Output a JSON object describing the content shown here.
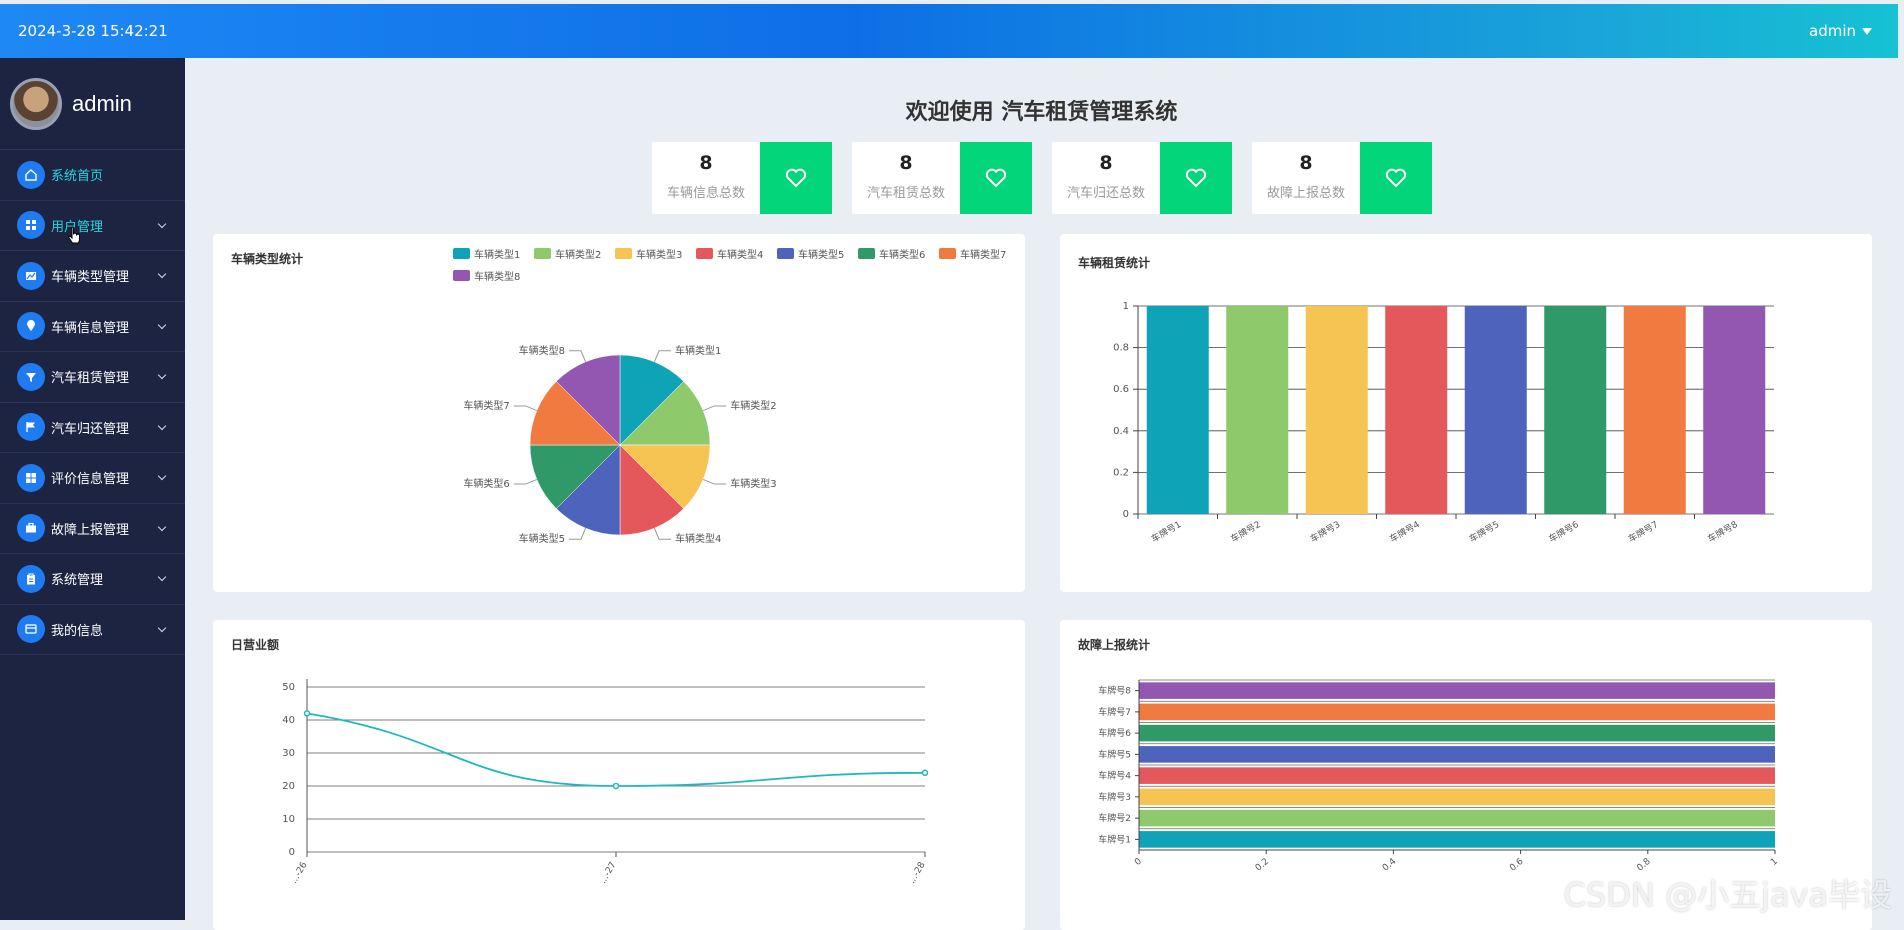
{
  "header": {
    "datetime": "2024-3-28 15:42:21",
    "user": "admin"
  },
  "sidebar": {
    "profile_name": "admin",
    "items": [
      {
        "label": "系统首页",
        "icon": "home-icon",
        "active": true,
        "has_chevron": false
      },
      {
        "label": "用户管理",
        "icon": "grid-icon",
        "active": false,
        "has_chevron": true
      },
      {
        "label": "车辆类型管理",
        "icon": "chart-icon",
        "active": false,
        "has_chevron": true
      },
      {
        "label": "车辆信息管理",
        "icon": "pin-icon",
        "active": false,
        "has_chevron": true
      },
      {
        "label": "汽车租赁管理",
        "icon": "filter-icon",
        "active": false,
        "has_chevron": true
      },
      {
        "label": "汽车归还管理",
        "icon": "flag-icon",
        "active": false,
        "has_chevron": true
      },
      {
        "label": "评价信息管理",
        "icon": "apps-icon",
        "active": false,
        "has_chevron": true
      },
      {
        "label": "故障上报管理",
        "icon": "briefcase-icon",
        "active": false,
        "has_chevron": true
      },
      {
        "label": "系统管理",
        "icon": "clipboard-icon",
        "active": false,
        "has_chevron": true
      },
      {
        "label": "我的信息",
        "icon": "card-icon",
        "active": false,
        "has_chevron": true
      }
    ]
  },
  "main": {
    "welcome": "欢迎使用 汽车租赁管理系统",
    "stats": [
      {
        "value": "8",
        "label": "车辆信息总数"
      },
      {
        "value": "8",
        "label": "汽车租赁总数"
      },
      {
        "value": "8",
        "label": "汽车归还总数"
      },
      {
        "value": "8",
        "label": "故障上报总数"
      }
    ],
    "stat_icon": "heart-icon",
    "stat_icon_color": "#03d67a"
  },
  "colors": [
    "#0fa3b8",
    "#8ec96c",
    "#f6c452",
    "#e4585c",
    "#4d63bc",
    "#2f9a68",
    "#f17a41",
    "#9157b1"
  ],
  "chart_data": [
    {
      "type": "pie",
      "title": "车辆类型统计",
      "categories": [
        "车辆类型1",
        "车辆类型2",
        "车辆类型3",
        "车辆类型4",
        "车辆类型5",
        "车辆类型6",
        "车辆类型7",
        "车辆类型8"
      ],
      "values": [
        1,
        1,
        1,
        1,
        1,
        1,
        1,
        1
      ],
      "legend": "top-right"
    },
    {
      "type": "bar",
      "title": "车辆租赁统计",
      "categories": [
        "车牌号1",
        "车牌号2",
        "车牌号3",
        "车牌号4",
        "车牌号5",
        "车牌号6",
        "车牌号7",
        "车牌号8"
      ],
      "values": [
        1,
        1,
        1,
        1,
        1,
        1,
        1,
        1
      ],
      "ylim": [
        0,
        1
      ],
      "yticks": [
        "0",
        "0.2",
        "0.4",
        "0.6",
        "0.8",
        "1"
      ]
    },
    {
      "type": "line",
      "title": "日营业额",
      "x": [
        "2024-3-26",
        "2024-3-27",
        "2024-3-28"
      ],
      "x_visible": [
        "...-26",
        "...-27",
        "...-28"
      ],
      "values": [
        42,
        20,
        24
      ],
      "ylim": [
        0,
        50
      ],
      "yticks": [
        "0",
        "10",
        "20",
        "30",
        "40",
        "50"
      ]
    },
    {
      "type": "bar",
      "orientation": "horizontal",
      "title": "故障上报统计",
      "categories": [
        "车牌号1",
        "车牌号2",
        "车牌号3",
        "车牌号4",
        "车牌号5",
        "车牌号6",
        "车牌号7",
        "车牌号8"
      ],
      "values": [
        1,
        1,
        1,
        1,
        1,
        1,
        1,
        1
      ],
      "xlim": [
        0,
        1
      ],
      "xticks": [
        "0",
        "0.2",
        "0.4",
        "0.6",
        "0.8",
        "1"
      ]
    }
  ],
  "watermark": "CSDN @小五java毕设"
}
